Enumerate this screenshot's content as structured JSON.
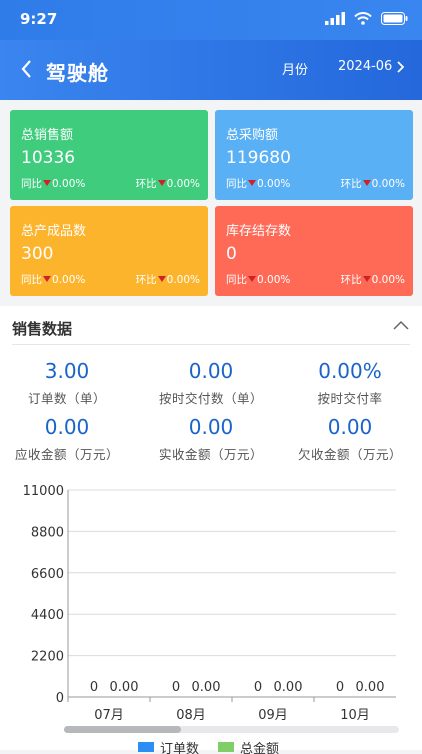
{
  "status_bar": {
    "time": "9:27"
  },
  "header": {
    "back_icon": "chevron-left-icon",
    "title": "驾驶舱",
    "month_label": "月份",
    "month_value": "2024-06"
  },
  "cards": [
    {
      "label": "总销售额",
      "value": "10336",
      "yoy_label": "同比",
      "yoy_value": "0.00%",
      "mom_label": "环比",
      "mom_value": "0.00%",
      "color": "#3fcd7d"
    },
    {
      "label": "总采购额",
      "value": "119680",
      "yoy_label": "同比",
      "yoy_value": "0.00%",
      "mom_label": "环比",
      "mom_value": "0.00%",
      "color": "#5ab0f4"
    },
    {
      "label": "总产成品数",
      "value": "300",
      "yoy_label": "同比",
      "yoy_value": "0.00%",
      "mom_label": "环比",
      "mom_value": "0.00%",
      "color": "#fdb42d"
    },
    {
      "label": "库存结存数",
      "value": "0",
      "yoy_label": "同比",
      "yoy_value": "0.00%",
      "mom_label": "环比",
      "mom_value": "0.00%",
      "color": "#ff6a57"
    }
  ],
  "sales": {
    "title": "销售数据",
    "stats": [
      {
        "value": "3.00",
        "label": "订单数（单）"
      },
      {
        "value": "0.00",
        "label": "按时交付数（单）"
      },
      {
        "value": "0.00%",
        "label": "按时交付率"
      },
      {
        "value": "0.00",
        "label": "应收金额（万元）"
      },
      {
        "value": "0.00",
        "label": "实收金额（万元）"
      },
      {
        "value": "0.00",
        "label": "欠收金额（万元）"
      }
    ]
  },
  "chart_data": {
    "type": "bar",
    "categories": [
      "07月",
      "08月",
      "09月",
      "10月"
    ],
    "series": [
      {
        "name": "订单数",
        "values": [
          0,
          0,
          0,
          0
        ],
        "labels": [
          "0",
          "0",
          "0",
          "0"
        ],
        "color": "#2c8ef5"
      },
      {
        "name": "总金额",
        "values": [
          0,
          0,
          0,
          0
        ],
        "labels": [
          "0.00",
          "0.00",
          "0.00",
          "0.00"
        ],
        "color": "#7fce68"
      }
    ],
    "yticks": [
      0,
      2200,
      4400,
      6600,
      8800,
      11000
    ],
    "ylim": [
      0,
      11000
    ],
    "grid": true,
    "legend": "bottom"
  }
}
